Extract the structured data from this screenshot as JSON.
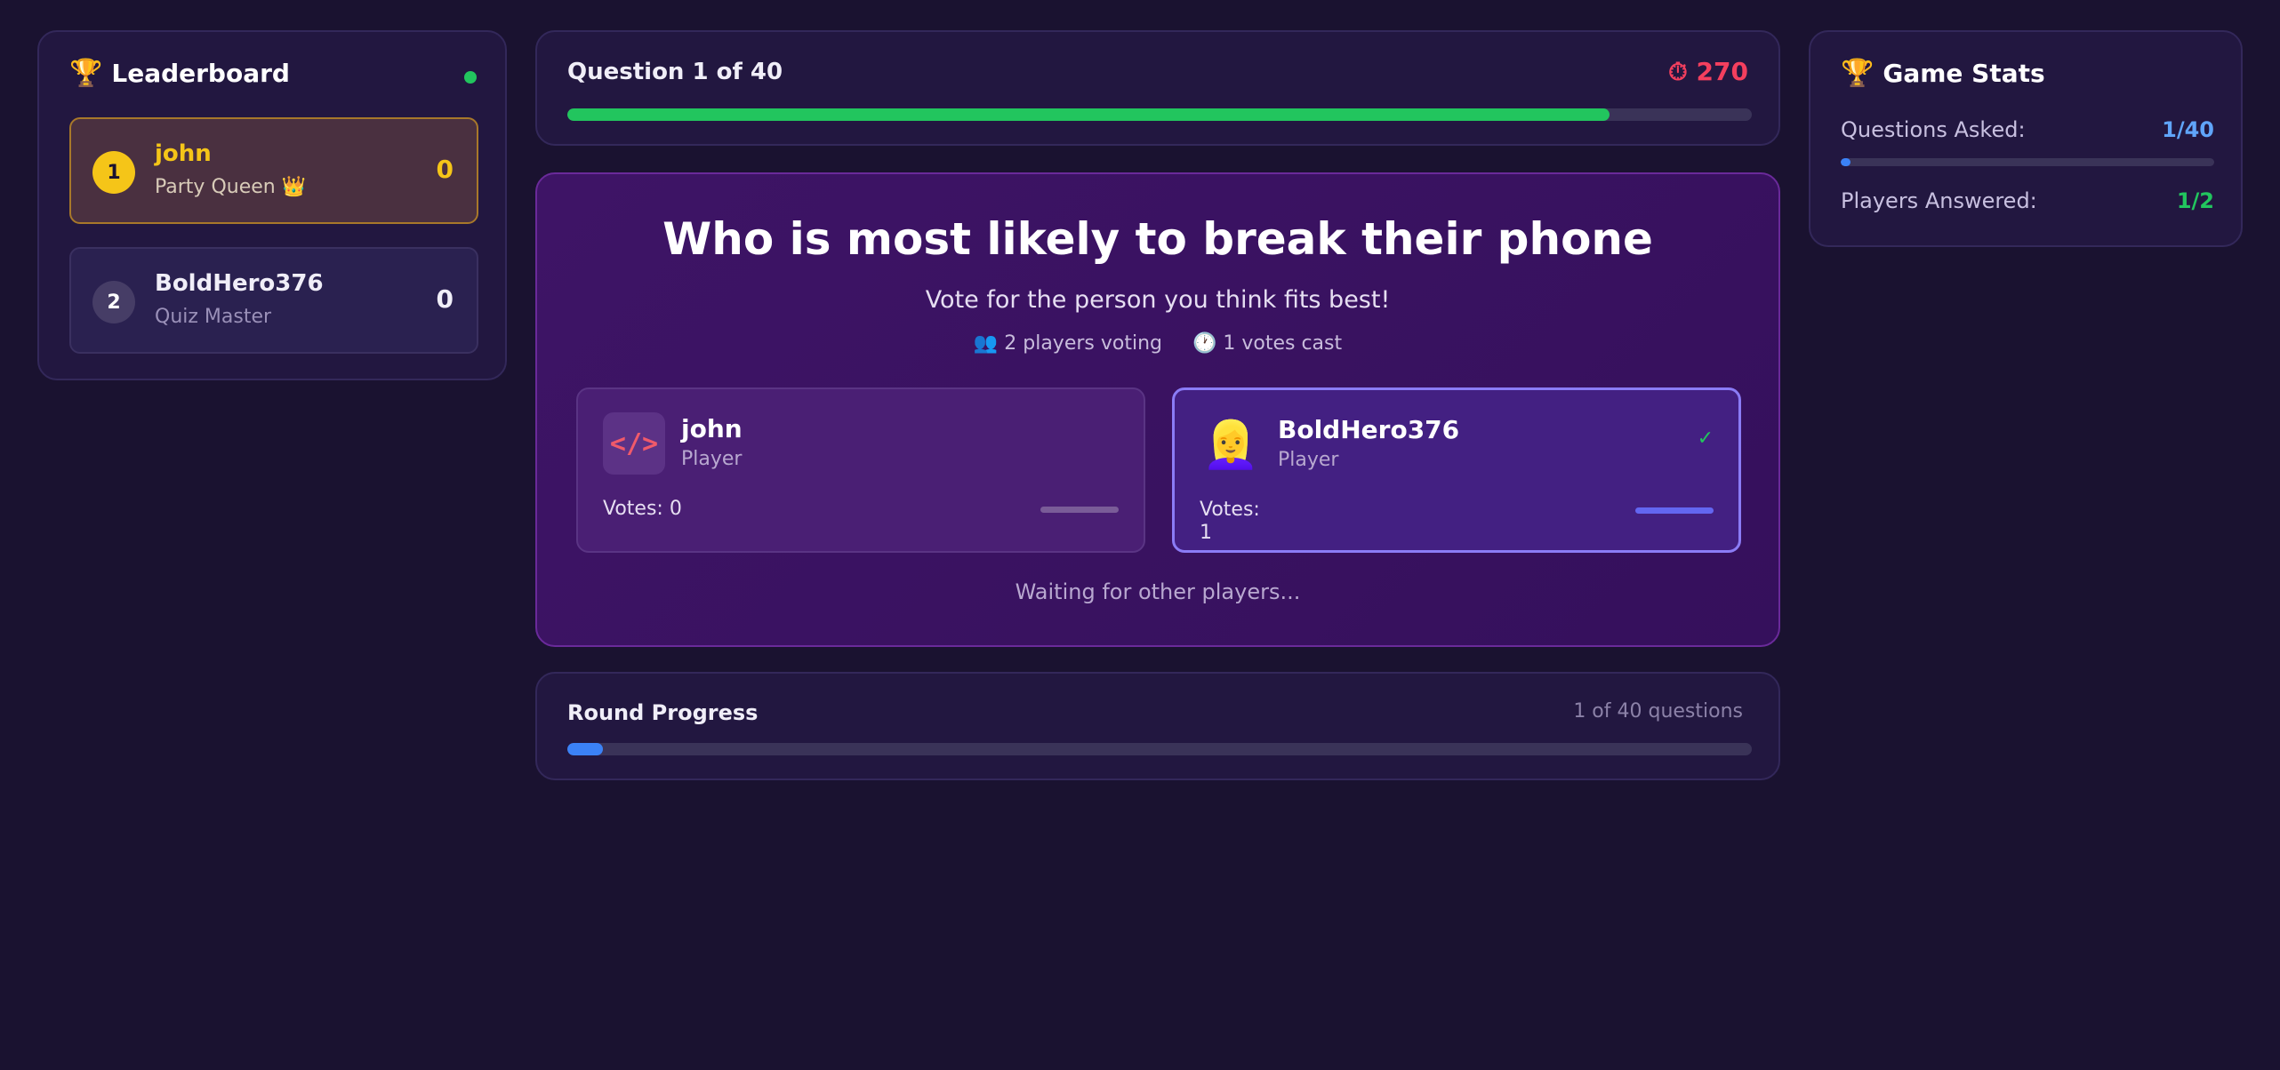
{
  "leaderboard": {
    "title": "Leaderboard",
    "players": [
      {
        "rank": "1",
        "name": "john",
        "subtitle": "Party Queen 👑",
        "score": "0"
      },
      {
        "rank": "2",
        "name": "BoldHero376",
        "subtitle": "Quiz Master",
        "score": "0"
      }
    ]
  },
  "question_header": {
    "title": "Question 1 of 40",
    "timer_icon": "⏱",
    "timer": "270",
    "time_remaining_fraction": 0.88
  },
  "question": {
    "text": "Who is most likely to break their phone",
    "instruction": "Vote for the person you think fits best!",
    "players_voting": "👥 2 players voting",
    "votes_cast": "🕐 1 votes cast",
    "options": [
      {
        "name": "john",
        "role": "Player",
        "votes_label": "Votes: 0",
        "avatar": "</>",
        "selected": false
      },
      {
        "name": "BoldHero376",
        "role": "Player",
        "votes_label": "Votes:",
        "votes_value": "1",
        "avatar": "👱‍♀️",
        "selected": true
      }
    ],
    "waiting": "Waiting for other players..."
  },
  "round": {
    "title": "Round Progress",
    "count": "1 of 40 questions",
    "progress_fraction": 0.03
  },
  "stats": {
    "title": "Game Stats",
    "questions_label": "Questions Asked:",
    "questions_value": "1/40",
    "questions_fraction": 0.025,
    "answered_label": "Players Answered:",
    "answered_value": "1/2"
  },
  "colors": {
    "background": "#1a1230",
    "accent_green": "#22c55e",
    "accent_gold": "#f5c518",
    "timer_red": "#f43f5e",
    "accent_blue": "#3b82f6"
  }
}
